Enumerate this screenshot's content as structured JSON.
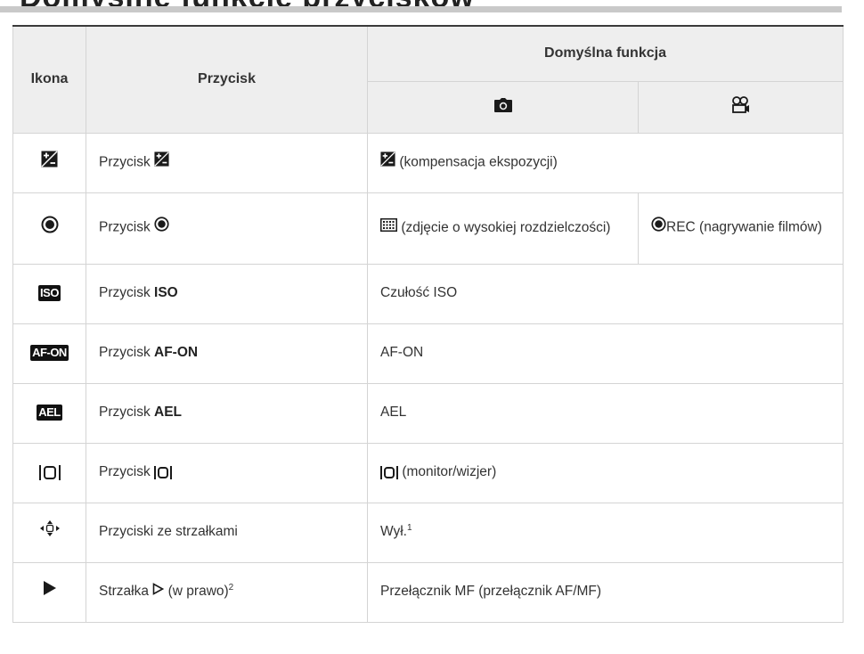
{
  "section_heading_fragment": "Domyślne funkcje przycisków",
  "table": {
    "headers": {
      "icon": "Ikona",
      "button": "Przycisk",
      "default_function": "Domyślna funkcja"
    },
    "subheader_icons": {
      "photo": "camera-icon",
      "movie": "movie-camera-icon"
    },
    "rows": [
      {
        "icon": "exposure-compensation-icon",
        "button_prefix": "Przycisk",
        "button_bold": "",
        "function": "(kompensacja ekspozycji)"
      },
      {
        "icon": "record-icon",
        "button_prefix": "Przycisk",
        "button_bold": "",
        "function_photo": "(zdjęcie o wysokiej rozdzielczości)",
        "function_movie": "REC (nagrywanie filmów)"
      },
      {
        "icon": "iso-badge-icon",
        "icon_text": "ISO",
        "button_prefix": "Przycisk",
        "button_bold": "ISO",
        "function": "Czułość ISO"
      },
      {
        "icon": "af-on-badge-icon",
        "icon_text": "AF-ON",
        "button_prefix": "Przycisk",
        "button_bold": "AF-ON",
        "function": "AF-ON"
      },
      {
        "icon": "ael-badge-icon",
        "icon_text": "AEL",
        "button_prefix": "Przycisk",
        "button_bold": "AEL",
        "function": "AEL"
      },
      {
        "icon": "monitor-viewfinder-icon",
        "button_prefix": "Przycisk",
        "button_bold": "",
        "function": "(monitor/wizjer)"
      },
      {
        "icon": "arrow-pad-icon",
        "button": "Przyciski ze strzałkami",
        "function": "Wył.",
        "function_sup": "1"
      },
      {
        "icon": "play-icon",
        "button_prefix": "Strzałka",
        "button_suffix": "(w prawo)",
        "button_sup": "2",
        "function": "Przełącznik MF (przełącznik AF/MF)"
      }
    ]
  }
}
